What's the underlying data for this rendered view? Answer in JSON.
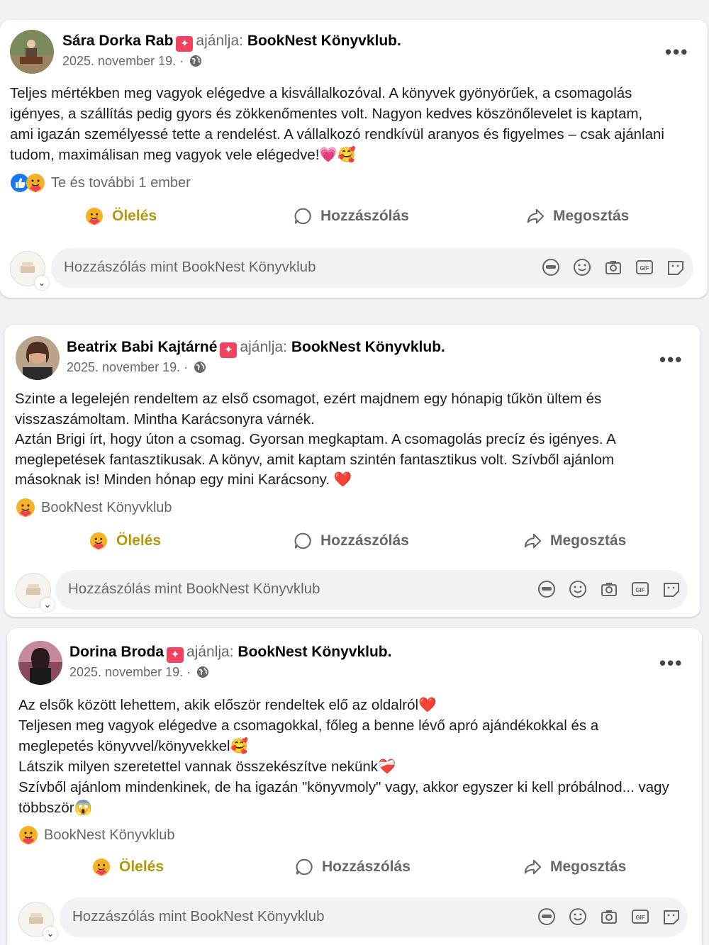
{
  "posts": [
    {
      "author": "Sára Dorka Rab",
      "recommends": "ajánlja:",
      "page": "BookNest Könyvklub",
      "date": "2025. november 19. ·",
      "lines": [
        "Teljes mértékben meg vagyok elégedve a kisvállalkozóval. A könyvek gyönyörűek, a csomagolás",
        "igényes, a szállítás pedig gyors és zökkenőmentes volt. Nagyon kedves köszönőlevelet is kaptam,",
        "ami igazán személyessé tette a rendelést. A vállalkozó rendkívül aranyos és figyelmes – csak ajánlani",
        "tudom, maximálisan meg vagyok vele elégedve!💗🥰"
      ],
      "reactions_text": "Te és további 1 ember"
    },
    {
      "author": "Beatrix Babi Kajtárné",
      "recommends": "ajánlja:",
      "page": "BookNest Könyvklub",
      "date": "2025. november 19. ·",
      "lines": [
        "Szinte a legelején rendeltem az első csomagot, ezért majdnem egy hónapig tűkön ültem és",
        "visszaszámoltam. Mintha Karácsonyra várnék.",
        "Aztán Brigi írt, hogy úton a csomag. Gyorsan megkaptam. A csomagolás precíz és igényes. A",
        "meglepetések fantasztikusak. A könyv, amit kaptam szintén fantasztikus volt. Szívből ajánlom",
        "másoknak is! Minden hónap egy mini Karácsony. ❤️"
      ],
      "reactions_text": "BookNest Könyvklub"
    },
    {
      "author": "Dorina Broda",
      "recommends": "ajánlja:",
      "page": "BookNest Könyvklub",
      "date": "2025. november 19. ·",
      "lines": [
        "Az elsők között lehettem, akik először rendeltek elő az oldalról❤️",
        "Teljesen meg vagyok elégedve a csomagokkal, főleg a benne lévő apró ajándékokkal és a",
        "meglepetés könyvvel/könyvekkel🥰",
        "Látszik milyen szeretettel vannak összekészítve nekünk❤️‍🩹",
        "Szívből ajánlom mindenkinek, de ha igazán \"könyvmoly\" vagy, akkor egyszer ki kell próbálnod... vagy",
        "többször😱"
      ],
      "reactions_text": "BookNest Könyvklub"
    }
  ],
  "actions": {
    "hug": "Ölelés",
    "comment": "Hozzászólás",
    "share": "Megosztás"
  },
  "comment_placeholder": "Hozzászólás mint BookNest Könyvklub",
  "icons": [
    "avatar-icon",
    "emoji-icon",
    "camera-icon",
    "gif-icon",
    "sticker-icon"
  ],
  "colors": {
    "hug": "#b7960b",
    "muted": "#65676b",
    "badge": "#f3425f",
    "like": "#1877f2"
  }
}
